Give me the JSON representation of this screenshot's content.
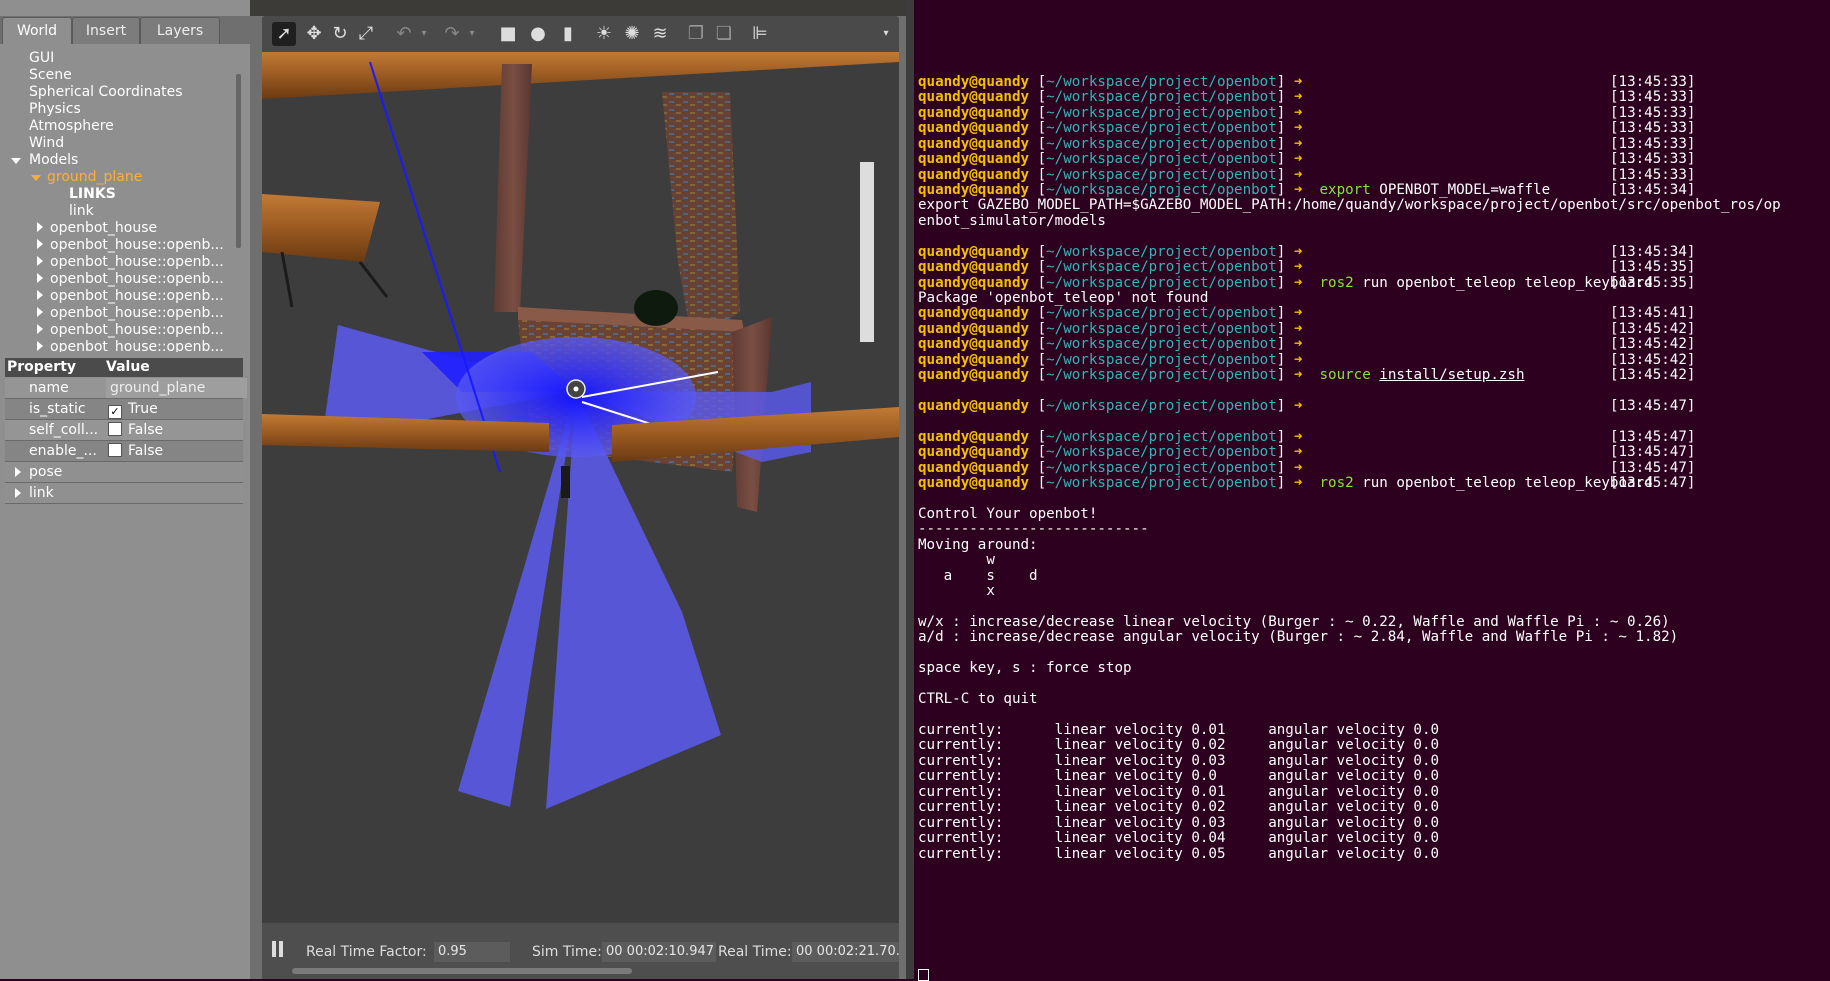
{
  "gazebo": {
    "tabs": [
      "World",
      "Insert",
      "Layers"
    ],
    "tree": {
      "items": [
        "GUI",
        "Scene",
        "Spherical Coordinates",
        "Physics",
        "Atmosphere",
        "Wind"
      ],
      "models_label": "Models",
      "ground_plane": "ground_plane",
      "links_label": "LINKS",
      "link_label": "link",
      "models": [
        "openbot_house",
        "openbot_house::openb...",
        "openbot_house::openb...",
        "openbot_house::openb...",
        "openbot_house::openb...",
        "openbot_house::openb...",
        "openbot_house::openb...",
        "openbot_house::openb..."
      ]
    },
    "properties": {
      "header_property": "Property",
      "header_value": "Value",
      "rows": [
        {
          "name": "name",
          "value": "ground_plane"
        },
        {
          "name": "is_static",
          "value": "True"
        },
        {
          "name": "self_coll...",
          "value": "False"
        },
        {
          "name": "enable_...",
          "value": "False"
        }
      ],
      "groups": [
        "pose",
        "link"
      ]
    },
    "bottom": {
      "rtf_label": "Real Time Factor:",
      "rtf_value": "0.95",
      "sim_label": "Sim Time:",
      "sim_value": "00 00:02:10.947",
      "real_label": "Real Time:",
      "real_value": "00 00:02:21.70..."
    },
    "colors": {
      "laser": "#2323ff",
      "panel": "#8f8f8f",
      "selected": "#ffae35"
    }
  },
  "terminal": {
    "user": "quandy@quandy",
    "path": "~/workspace/project/openbot",
    "arrow": "➜",
    "lines": [
      {
        "type": "prompt",
        "cmd": "",
        "time": "[13:45:33]"
      },
      {
        "type": "prompt",
        "cmd": "",
        "time": "[13:45:33]"
      },
      {
        "type": "prompt",
        "cmd": "",
        "time": "[13:45:33]"
      },
      {
        "type": "prompt",
        "cmd": "",
        "time": "[13:45:33]"
      },
      {
        "type": "prompt",
        "cmd": "",
        "time": "[13:45:33]"
      },
      {
        "type": "prompt",
        "cmd": "",
        "time": "[13:45:33]"
      },
      {
        "type": "prompt",
        "cmd": "",
        "time": "[13:45:33]"
      },
      {
        "type": "prompt",
        "cmd": "export",
        "rest": " OPENBOT_MODEL=waffle",
        "time": "[13:45:34]"
      },
      {
        "type": "text",
        "text": "export GAZEBO_MODEL_PATH=$GAZEBO_MODEL_PATH:/home/quandy/workspace/project/openbot/src/openbot_ros/op"
      },
      {
        "type": "text",
        "text": "enbot_simulator/models"
      },
      {
        "type": "text",
        "text": ""
      },
      {
        "type": "prompt",
        "cmd": "",
        "time": "[13:45:34]"
      },
      {
        "type": "prompt",
        "cmd": "",
        "time": "[13:45:35]"
      },
      {
        "type": "prompt",
        "cmd": "ros2",
        "rest": " run openbot_teleop teleop_keyboard",
        "time": "[13:45:35]"
      },
      {
        "type": "text",
        "text": "Package 'openbot_teleop' not found"
      },
      {
        "type": "prompt",
        "cmd": "",
        "time": "[13:45:41]"
      },
      {
        "type": "prompt",
        "cmd": "",
        "time": "[13:45:42]"
      },
      {
        "type": "prompt",
        "cmd": "",
        "time": "[13:45:42]"
      },
      {
        "type": "prompt",
        "cmd": "",
        "time": "[13:45:42]"
      },
      {
        "type": "prompt",
        "cmd": "source",
        "rest_ul": "install/setup.zsh",
        "time": "[13:45:42]"
      },
      {
        "type": "text",
        "text": ""
      },
      {
        "type": "prompt",
        "cmd": "",
        "time": "[13:45:47]"
      },
      {
        "type": "text",
        "text": ""
      },
      {
        "type": "prompt",
        "cmd": "",
        "time": "[13:45:47]"
      },
      {
        "type": "prompt",
        "cmd": "",
        "time": "[13:45:47]"
      },
      {
        "type": "prompt",
        "cmd": "",
        "time": "[13:45:47]"
      },
      {
        "type": "prompt",
        "cmd": "ros2",
        "rest": " run openbot_teleop teleop_keyboard",
        "time": "[13:45:47]"
      },
      {
        "type": "text",
        "text": ""
      },
      {
        "type": "text",
        "text": "Control Your openbot!"
      },
      {
        "type": "text",
        "text": "---------------------------"
      },
      {
        "type": "text",
        "text": "Moving around:"
      },
      {
        "type": "text",
        "text": "        w"
      },
      {
        "type": "text",
        "text": "   a    s    d"
      },
      {
        "type": "text",
        "text": "        x"
      },
      {
        "type": "text",
        "text": ""
      },
      {
        "type": "text",
        "text": "w/x : increase/decrease linear velocity (Burger : ~ 0.22, Waffle and Waffle Pi : ~ 0.26)"
      },
      {
        "type": "text",
        "text": "a/d : increase/decrease angular velocity (Burger : ~ 2.84, Waffle and Waffle Pi : ~ 1.82)"
      },
      {
        "type": "text",
        "text": ""
      },
      {
        "type": "text",
        "text": "space key, s : force stop"
      },
      {
        "type": "text",
        "text": ""
      },
      {
        "type": "text",
        "text": "CTRL-C to quit"
      },
      {
        "type": "text",
        "text": ""
      },
      {
        "type": "text",
        "text": "currently:      linear velocity 0.01     angular velocity 0.0"
      },
      {
        "type": "text",
        "text": "currently:      linear velocity 0.02     angular velocity 0.0"
      },
      {
        "type": "text",
        "text": "currently:      linear velocity 0.03     angular velocity 0.0"
      },
      {
        "type": "text",
        "text": "currently:      linear velocity 0.0      angular velocity 0.0"
      },
      {
        "type": "text",
        "text": "currently:      linear velocity 0.01     angular velocity 0.0"
      },
      {
        "type": "text",
        "text": "currently:      linear velocity 0.02     angular velocity 0.0"
      },
      {
        "type": "text",
        "text": "currently:      linear velocity 0.03     angular velocity 0.0"
      },
      {
        "type": "text",
        "text": "currently:      linear velocity 0.04     angular velocity 0.0"
      },
      {
        "type": "text",
        "text": "currently:      linear velocity 0.05     angular velocity 0.0"
      }
    ],
    "colors": {
      "background": "#2c001e",
      "user": "#f4c000",
      "path": "#34b4b4",
      "command": "#8ae234"
    }
  }
}
